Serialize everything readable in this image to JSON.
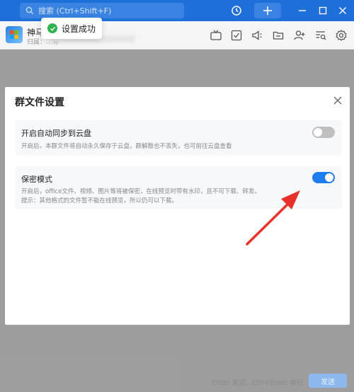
{
  "search": {
    "placeholder": "搜索 (Ctrl+Shift+F)"
  },
  "chat": {
    "group_name": "神马",
    "group_sub": "归属：…有"
  },
  "toast": {
    "message": "设置成功"
  },
  "dialog": {
    "title": "群文件设置",
    "sync": {
      "title": "开启自动同步到云盘",
      "desc": "开启后，本群文件将自动永久保存于云盘，群解散也不丢失，也可前往云盘查看",
      "enabled": false
    },
    "secret": {
      "title": "保密模式",
      "desc1": "开启后，office文件、视频、图片等将被保密，在线预览时带有水印，且不可下载、转发。",
      "desc2": "提示：其他格式的文件暂不能在线预览，所以仍可以下载。",
      "enabled": true
    }
  },
  "footer": {
    "hint": "Enter 发送，Ctrl+Enter 换行",
    "send_label": "发送"
  },
  "colors": {
    "accent": "#1e6fd9",
    "toggle_on": "#1e7ef0",
    "toast_ok": "#2fb34c",
    "arrow": "#e8312a"
  }
}
